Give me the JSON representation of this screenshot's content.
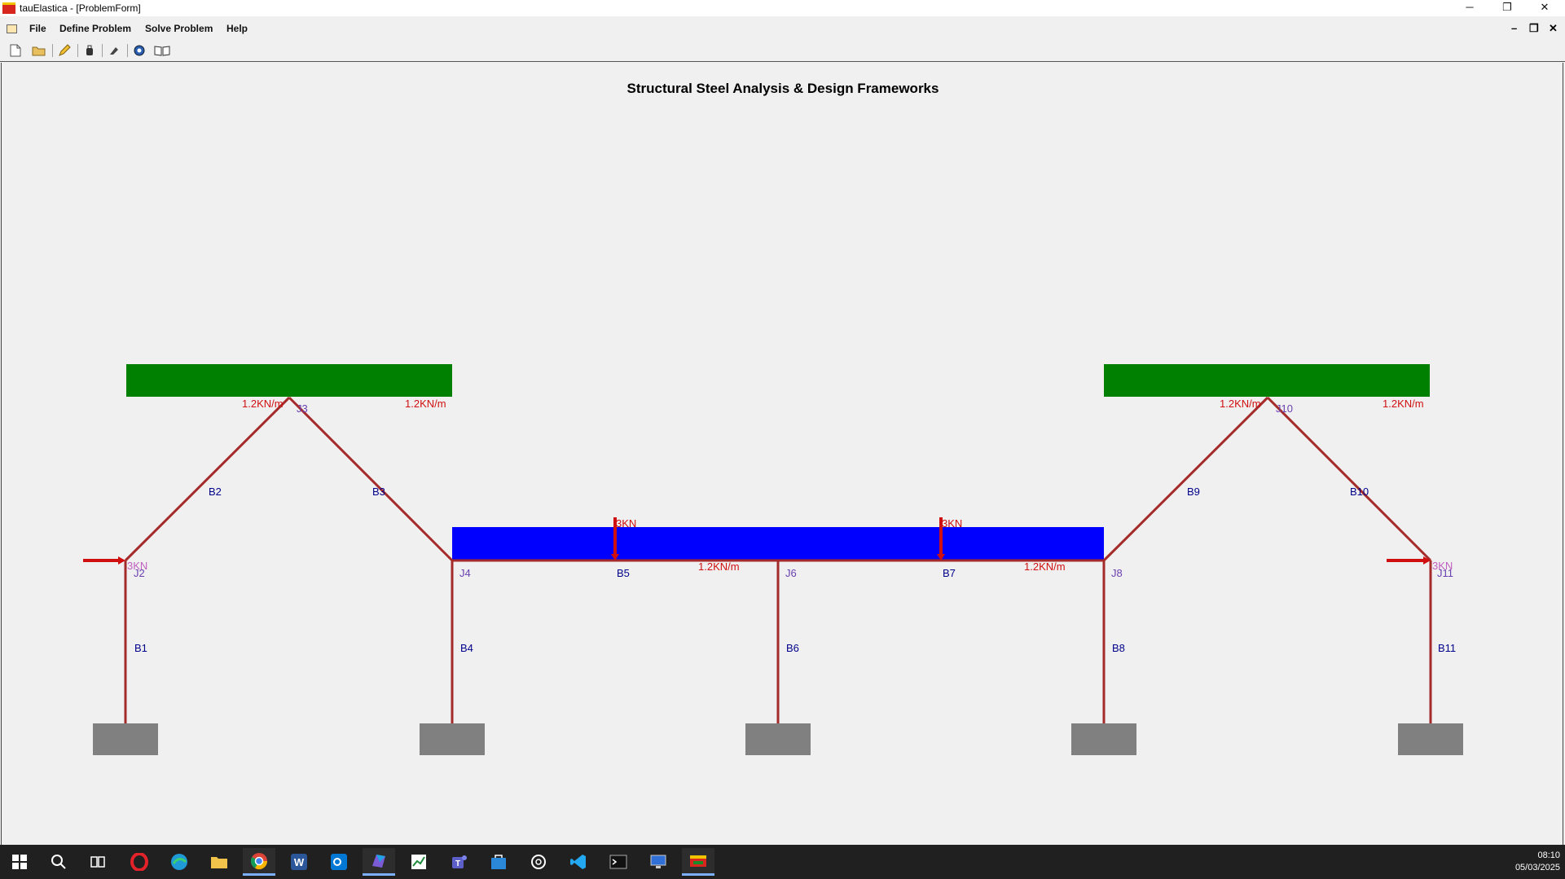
{
  "window": {
    "title": "tauElastica - [ProblemForm]"
  },
  "menu": {
    "items": [
      "File",
      "Define Problem",
      "Solve Problem",
      "Help"
    ]
  },
  "toolbar": {
    "buttons": [
      "new",
      "open",
      "edit",
      "load",
      "erase",
      "solve",
      "report"
    ]
  },
  "drawing": {
    "title": "Structural Steel Analysis & Design Frameworks",
    "joints": [
      "J2",
      "J3",
      "J4",
      "J6",
      "J8",
      "J10",
      "J11"
    ],
    "beams": [
      "B1",
      "B2",
      "B3",
      "B4",
      "B5",
      "B6",
      "B7",
      "B8",
      "B9",
      "B10",
      "B11"
    ],
    "udl_label": "1.2KN/m",
    "point_load_label": "3KN",
    "colors": {
      "member": "#a52a2a",
      "roof_load": "#008000",
      "floor_load": "#0000ff",
      "support": "#808080",
      "beam_label": "#00008b",
      "joint_label": "#6a3fb0",
      "load_label": "#d01010",
      "point_load": "#d01010"
    }
  },
  "taskbar": {
    "time": "08:10",
    "date": "05/03/2025"
  }
}
